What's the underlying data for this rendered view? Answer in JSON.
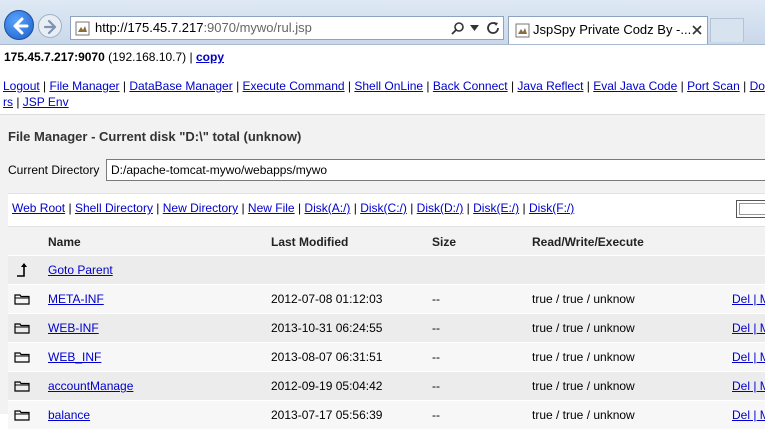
{
  "browser": {
    "address_host": "http://175.45.7.217",
    "address_rest": ":9070/mywo/rul.jsp",
    "tab_title": "JspSpy Private Codz By -...",
    "icons": {
      "back": "back-arrow-icon",
      "forward": "forward-arrow-icon",
      "search": "search-icon",
      "refresh": "refresh-icon",
      "close": "close-icon"
    }
  },
  "host": {
    "address": "175.45.7.217:9070",
    "local_ip": "(192.168.10.7)",
    "separator": "|",
    "copy_label": "copy"
  },
  "menu": {
    "row1": [
      "Logout",
      "File Manager",
      "DataBase Manager",
      "Execute Command",
      "Shell OnLine",
      "Back Connect",
      "Java Reflect",
      "Eval Java Code",
      "Port Scan",
      "Do"
    ],
    "row2": [
      "rs",
      "JSP Env"
    ]
  },
  "file_manager": {
    "title": "File Manager - Current disk \"D:\\\" total (unknow)",
    "current_dir_label": "Current Directory",
    "current_dir_value": "D:/apache-tomcat-mywo/webapps/mywo",
    "quick_links": [
      "Web Root",
      "Shell Directory",
      "New Directory",
      "New File",
      "Disk(A:/)",
      "Disk(C:/)",
      "Disk(D:/)",
      "Disk(E:/)",
      "Disk(F:/)"
    ]
  },
  "table": {
    "headers": {
      "name": "Name",
      "modified": "Last Modified",
      "size": "Size",
      "rwx": "Read/Write/Execute"
    },
    "goto_parent": "Goto Parent",
    "rows": [
      {
        "name": "META-INF",
        "modified": "2012-07-08 01:12:03",
        "size": "--",
        "rwx": "true / true / unknow",
        "action": "Del | M"
      },
      {
        "name": "WEB-INF",
        "modified": "2013-10-31 06:24:55",
        "size": "--",
        "rwx": "true / true / unknow",
        "action": "Del | M"
      },
      {
        "name": "WEB_INF",
        "modified": "2013-08-07 06:31:51",
        "size": "--",
        "rwx": "true / true / unknow",
        "action": "Del | M"
      },
      {
        "name": "accountManage",
        "modified": "2012-09-19 05:04:42",
        "size": "--",
        "rwx": "true / true / unknow",
        "action": "Del | M"
      },
      {
        "name": "balance",
        "modified": "2013-07-17 05:56:39",
        "size": "--",
        "rwx": "true / true / unknow",
        "action": "Del | M"
      }
    ]
  },
  "colors": {
    "link": "#0000cc",
    "content_bg": "#f2f2f2",
    "row_even": "#ececec",
    "row_odd": "#f7f7f7"
  }
}
